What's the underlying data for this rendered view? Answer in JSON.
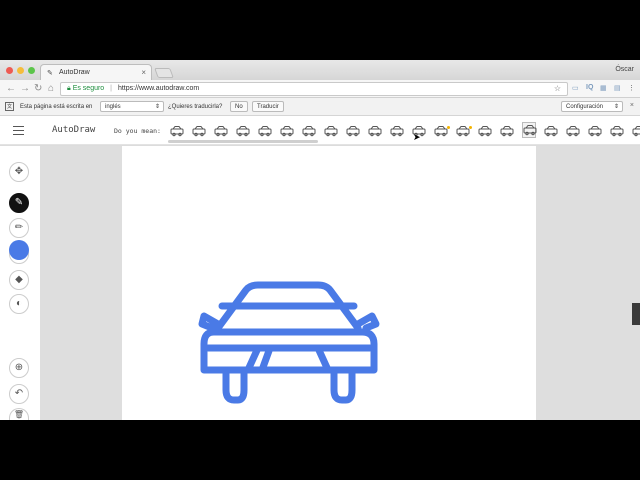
{
  "browser": {
    "tab_title": "AutoDraw",
    "tab_favicon": "✎",
    "tab_close": "×",
    "user_name": "Óscar",
    "secure_label": "Es seguro",
    "url": "https://www.autodraw.com",
    "address_separator": "|"
  },
  "translate_bar": {
    "prefix": "Esta página está escrita en",
    "language": "inglés",
    "question": "¿Quieres traducirla?",
    "no_label": "No",
    "translate_label": "Traducir",
    "settings_label": "Configuración",
    "close": "×"
  },
  "autodraw": {
    "brand": "AutoDraw",
    "suggest_prompt": "Do you mean:",
    "suggestions": [
      "bus",
      "tram",
      "ambulance",
      "limo",
      "tank-car",
      "robot",
      "sportscar",
      "car",
      "sedan",
      "van",
      "jeep",
      "truck",
      "coupe",
      "roadster",
      "car-outline",
      "pickup",
      "car-front-selected",
      "racecar",
      "minivan",
      "hatchback",
      "bottle-car",
      "bus2"
    ]
  },
  "colors": {
    "drawing_stroke": "#4a7ae6",
    "accent": "#4a7ae6",
    "secure_green": "#1e8e3e"
  },
  "icons": {
    "move": "move-icon",
    "autodraw": "autodraw-magic-icon",
    "pencil": "pencil-icon",
    "text": "text-icon",
    "fill": "fill-bucket-icon",
    "shape": "shape-icon",
    "zoom": "zoom-icon",
    "undo": "undo-icon",
    "trash": "trash-icon"
  }
}
